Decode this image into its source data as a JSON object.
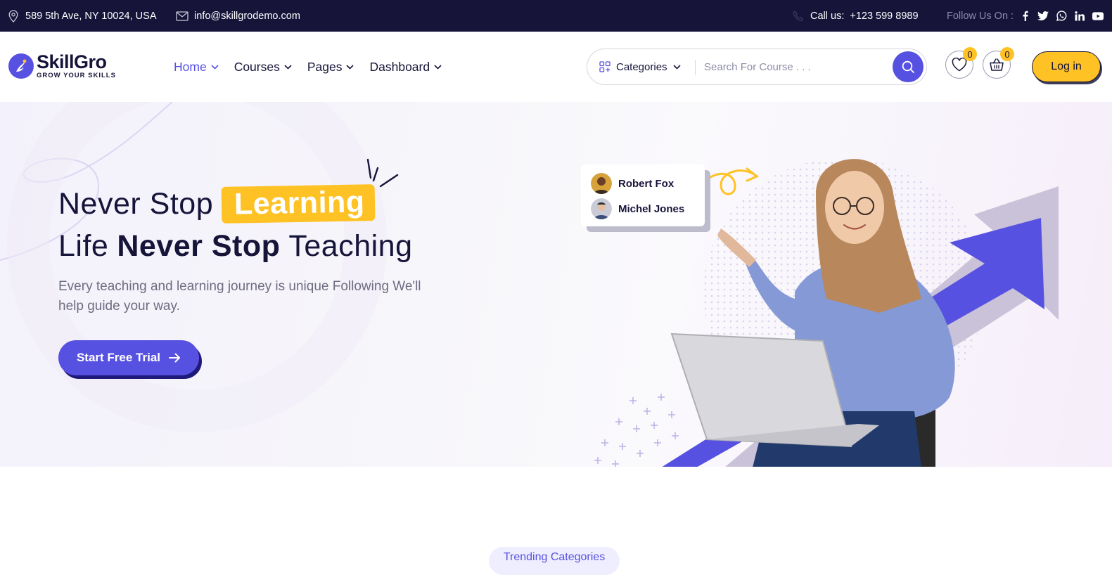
{
  "topbar": {
    "address": "589 5th Ave, NY 10024, USA",
    "email": "info@skillgrodemo.com",
    "call_label": "Call us:",
    "phone": "+123 599 8989",
    "follow_label": "Follow Us On :",
    "socials": [
      "facebook-icon",
      "twitter-icon",
      "whatsapp-icon",
      "linkedin-icon",
      "youtube-icon"
    ]
  },
  "header": {
    "logo_name": "SkillGro",
    "logo_tagline": "GROW YOUR SKILLS",
    "nav": [
      {
        "label": "Home",
        "active": true
      },
      {
        "label": "Courses"
      },
      {
        "label": "Pages"
      },
      {
        "label": "Dashboard"
      }
    ],
    "categories_label": "Categories",
    "search_placeholder": "Search For Course . . .",
    "wishlist_count": "0",
    "cart_count": "0",
    "login_label": "Log in"
  },
  "hero": {
    "line1_prefix": "Never Stop",
    "line1_highlight": "Learning",
    "line2_prefix": "Life",
    "line2_strong": "Never Stop",
    "line2_suffix": "Teaching",
    "subtitle": "Every teaching and learning journey is unique Following We'll help guide your way.",
    "cta_label": "Start Free Trial",
    "people": [
      "Robert Fox",
      "Michel Jones"
    ]
  },
  "section": {
    "pill_label": "Trending Categories"
  },
  "colors": {
    "primary": "#5751e1",
    "accent": "#ffc224",
    "dark": "#161439"
  }
}
